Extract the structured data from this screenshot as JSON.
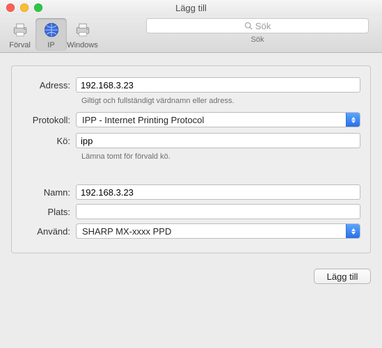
{
  "window": {
    "title": "Lägg till"
  },
  "toolbar": {
    "items": [
      {
        "label": "Förval"
      },
      {
        "label": "IP"
      },
      {
        "label": "Windows"
      }
    ],
    "search": {
      "placeholder": "Sök",
      "sublabel": "Sök"
    }
  },
  "form": {
    "address": {
      "label": "Adress:",
      "value": "192.168.3.23",
      "hint": "Giltigt och fullständigt värdnamn eller adress."
    },
    "protocol": {
      "label": "Protokoll:",
      "value": "IPP - Internet Printing Protocol"
    },
    "queue": {
      "label": "Kö:",
      "value": "ipp",
      "hint": "Lämna tomt för förvald kö."
    },
    "name": {
      "label": "Namn:",
      "value": "192.168.3.23"
    },
    "location": {
      "label": "Plats:",
      "value": ""
    },
    "use": {
      "label": "Använd:",
      "value": "SHARP MX-xxxx PPD"
    }
  },
  "footer": {
    "add_label": "Lägg till"
  }
}
